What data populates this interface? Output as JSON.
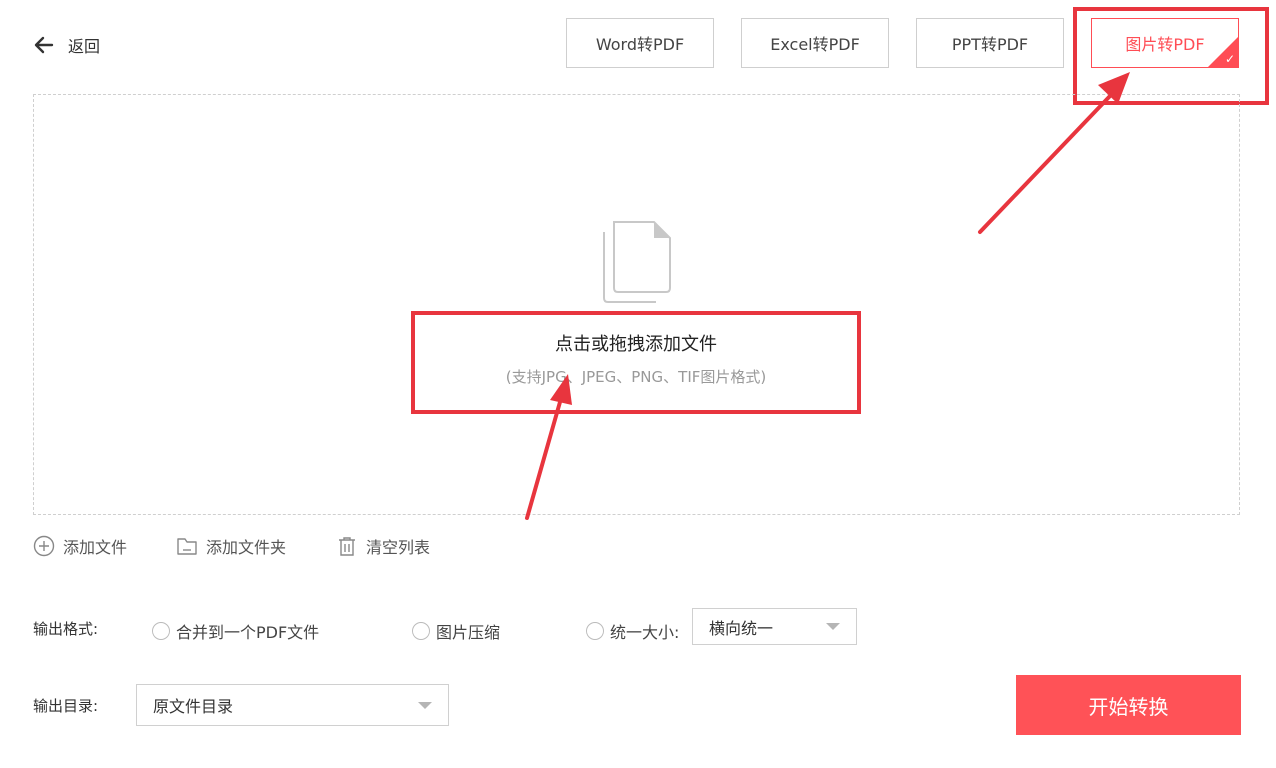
{
  "header": {
    "back_label": "返回",
    "tabs": [
      {
        "label": "Word转PDF",
        "active": false
      },
      {
        "label": "Excel转PDF",
        "active": false
      },
      {
        "label": "PPT转PDF",
        "active": false
      },
      {
        "label": "图片转PDF",
        "active": true
      }
    ]
  },
  "dropzone": {
    "icon": "document-stack-icon",
    "title": "点击或拖拽添加文件",
    "subtitle": "(支持JPG、JPEG、PNG、TIF图片格式)"
  },
  "actions": [
    {
      "label": "添加文件",
      "icon": "plus-circle-icon"
    },
    {
      "label": "添加文件夹",
      "icon": "folder-icon"
    },
    {
      "label": "清空列表",
      "icon": "trash-icon"
    }
  ],
  "output_format": {
    "label": "输出格式:",
    "options": [
      {
        "label": "合并到一个PDF文件"
      },
      {
        "label": "图片压缩"
      },
      {
        "label": "统一大小:"
      }
    ],
    "size_select_value": "横向统一"
  },
  "output_dir": {
    "label": "输出目录:",
    "value": "原文件目录"
  },
  "start_button": "开始转换",
  "colors": {
    "accent": "#ff5257",
    "highlight": "#e8353e"
  }
}
